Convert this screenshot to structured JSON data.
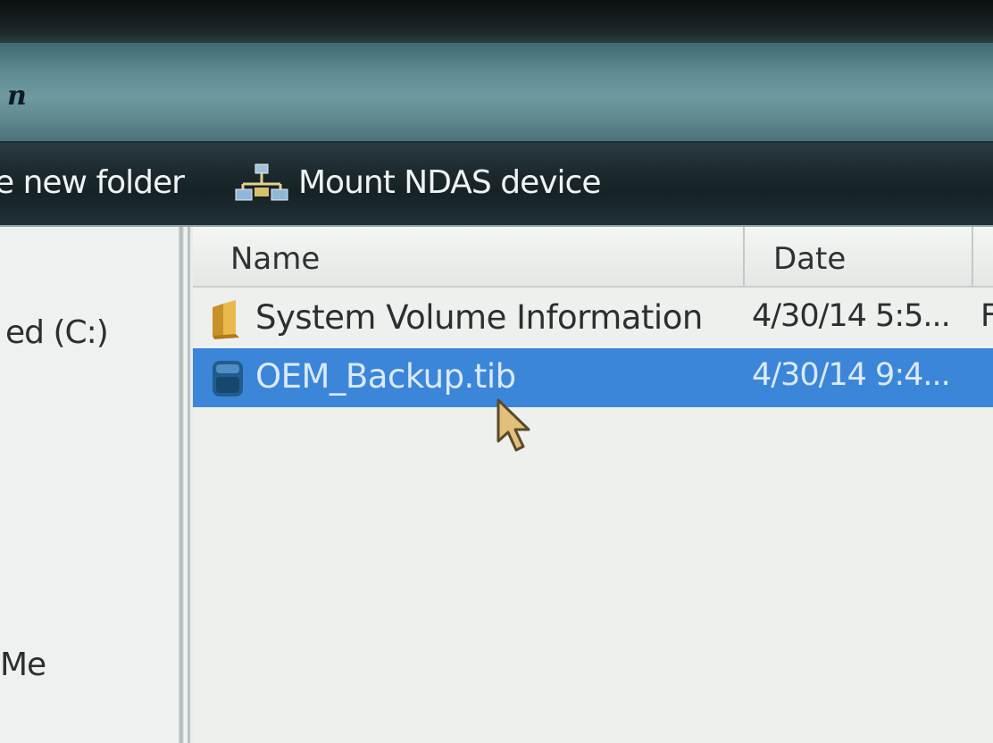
{
  "window": {
    "title_fragment": "n"
  },
  "toolbar": {
    "new_folder_label": "e new folder",
    "mount_ndas_label": "Mount NDAS device",
    "mount_ndas_icon": "network-drive-icon"
  },
  "navigation": {
    "items": [
      {
        "label": "ed (C:)"
      },
      {
        "label": "Me"
      }
    ]
  },
  "file_list": {
    "columns": [
      {
        "label": "Name"
      },
      {
        "label": "Date"
      }
    ],
    "rows": [
      {
        "name": "System Volume Information",
        "date": "4/30/14 5:5...",
        "extra": "F",
        "icon": "folder-icon",
        "selected": false
      },
      {
        "name": "OEM_Backup.tib",
        "date": "4/30/14 9:4...",
        "icon": "backup-file-icon",
        "selected": true
      }
    ]
  },
  "colors": {
    "selection": "#3b86d9",
    "toolbar": "#1c2a2e",
    "titlebar": "#5d8c92"
  }
}
